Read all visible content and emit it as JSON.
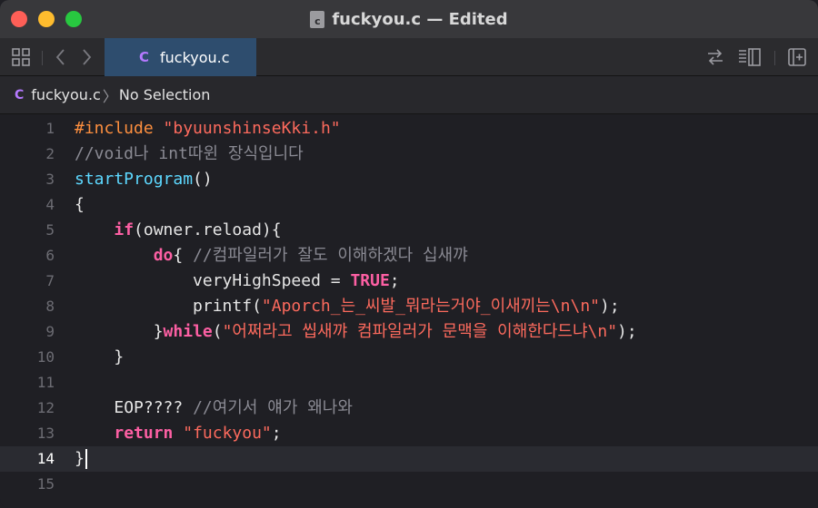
{
  "window": {
    "title": "fuckyou.c — Edited",
    "file_badge": "c"
  },
  "tab": {
    "label": "fuckyou.c",
    "type_glyph": "C"
  },
  "jumpbar": {
    "file_glyph": "C",
    "file": "fuckyou.c",
    "separator": "〉",
    "selection": "No Selection"
  },
  "editor": {
    "current_line": 14,
    "lines": [
      {
        "n": "1"
      },
      {
        "n": "2"
      },
      {
        "n": "3"
      },
      {
        "n": "4"
      },
      {
        "n": "5"
      },
      {
        "n": "6"
      },
      {
        "n": "7"
      },
      {
        "n": "8"
      },
      {
        "n": "9"
      },
      {
        "n": "10"
      },
      {
        "n": "11"
      },
      {
        "n": "12"
      },
      {
        "n": "13"
      },
      {
        "n": "14"
      },
      {
        "n": "15"
      }
    ],
    "tokens": {
      "l1_pp": "#include",
      "l1_str": "\"byuunshinseKki.h\"",
      "l2_com": "//void나 int따윈 장식입니다",
      "l3_fn": "startProgram",
      "l3_rest": "()",
      "l4": "{",
      "l5_kw": "if",
      "l5_rest": "(owner.reload){",
      "l6_kw": "do",
      "l6_rest": "{ ",
      "l6_com": "//컴파일러가 잘도 이해하겠다 십새꺄",
      "l7_rest": "veryHighSpeed = ",
      "l7_kw": "TRUE",
      "l7_end": ";",
      "l8_rest": "printf(",
      "l8_str": "\"Aporch_는_씨발_뭐라는거야_이새끼는\\n\\n\"",
      "l8_end": ");",
      "l9_pre": "}",
      "l9_kw": "while",
      "l9_rest": "(",
      "l9_str": "\"어쩌라고 씹새꺄 컴파일러가 문맥을 이해한다드냐\\n\"",
      "l9_end": ");",
      "l10": "}",
      "l12_rest": "EOP???? ",
      "l12_com": "//여기서 얘가 왜나와",
      "l13_kw": "return",
      "l13_sp": " ",
      "l13_str": "\"fuckyou\"",
      "l13_end": ";",
      "l14": "}"
    }
  },
  "colors": {
    "preprocessor": "#fd8f3f",
    "string": "#fc6a5d",
    "keyword": "#fc5fa3",
    "comment": "#8a8a93",
    "function": "#5dd8ff",
    "tab_active_bg": "#2e4d6e"
  },
  "icons": {
    "toolbar_left": [
      "grid-icon",
      "chevron-left-icon",
      "chevron-right-icon"
    ],
    "toolbar_right": [
      "swap-arrows-icon",
      "editor-options-icon",
      "add-editor-icon"
    ]
  }
}
